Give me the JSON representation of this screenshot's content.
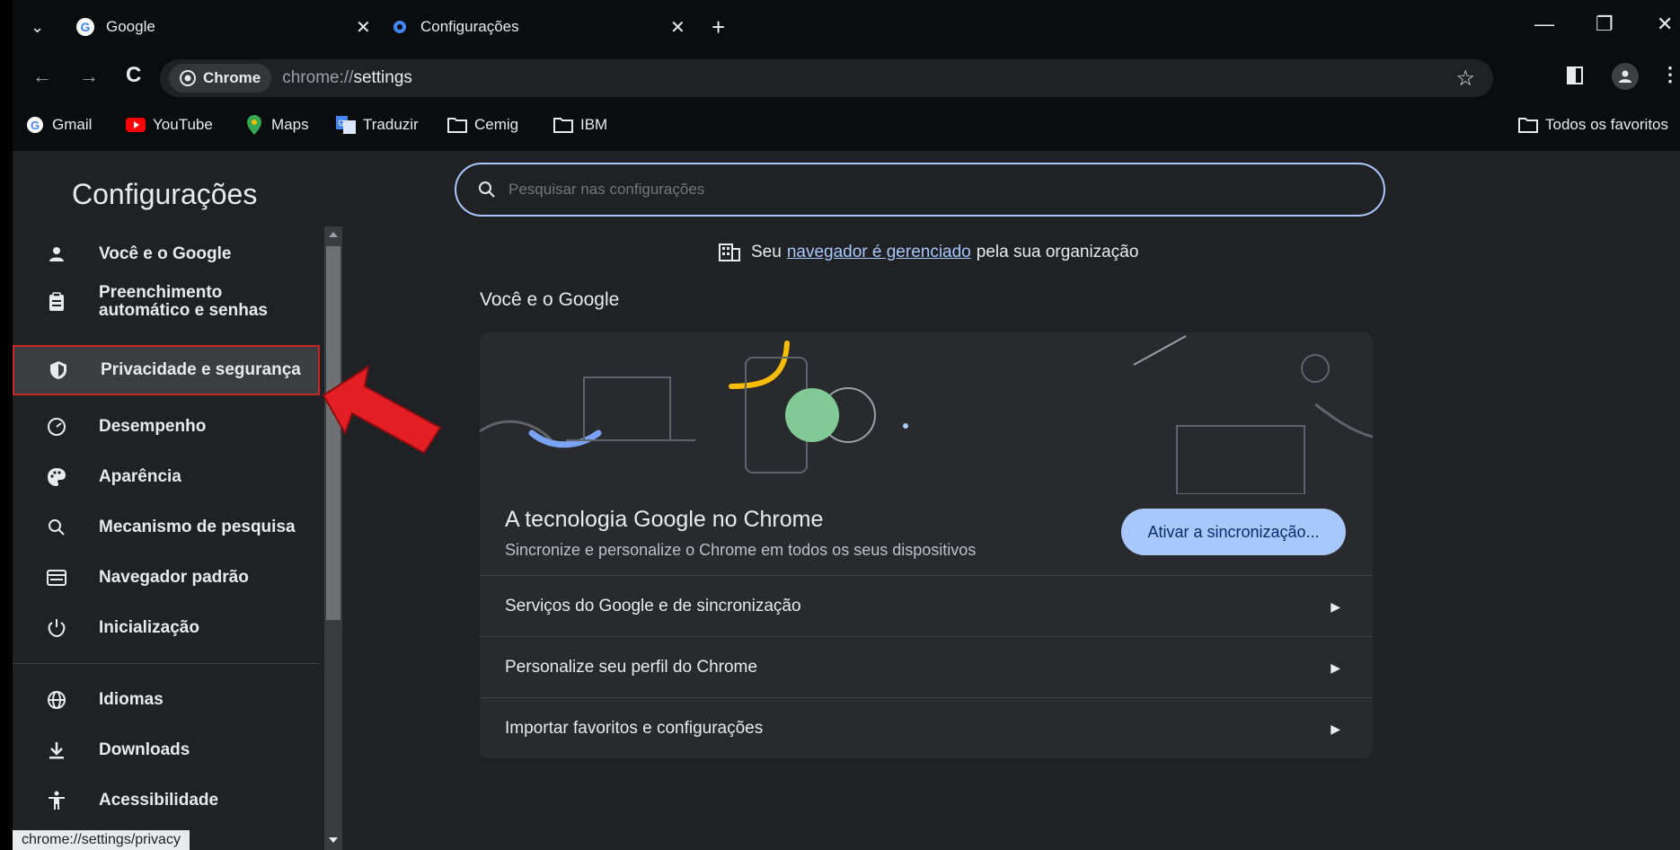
{
  "tabs": [
    {
      "title": "Google",
      "close": "✕"
    },
    {
      "title": "Configurações",
      "close": "✕"
    }
  ],
  "new_tab": "+",
  "tab_menu": "⌄",
  "window_controls": {
    "minimize": "—",
    "restore": "❐",
    "close": "✕"
  },
  "omnibox": {
    "chip": "Chrome",
    "url_prefix": "chrome://",
    "url_path": "settings"
  },
  "bookmarks": [
    {
      "label": "Gmail",
      "icon": "google-icon"
    },
    {
      "label": "YouTube",
      "icon": "youtube-icon"
    },
    {
      "label": "Maps",
      "icon": "maps-pin-icon"
    },
    {
      "label": "Traduzir",
      "icon": "translate-icon"
    },
    {
      "label": "Cemig",
      "icon": "folder-icon"
    },
    {
      "label": "IBM",
      "icon": "folder-icon"
    }
  ],
  "all_bookmarks": "Todos os favoritos",
  "sidebar": {
    "title": "Configurações",
    "items": [
      {
        "label": "Você e o Google",
        "icon": "person-icon"
      },
      {
        "label": "Preenchimento automático e senhas",
        "icon": "clipboard-icon"
      },
      {
        "label": "Privacidade e segurança",
        "icon": "shield-icon"
      },
      {
        "label": "Desempenho",
        "icon": "speedometer-icon"
      },
      {
        "label": "Aparência",
        "icon": "palette-icon"
      },
      {
        "label": "Mecanismo de pesquisa",
        "icon": "search-icon"
      },
      {
        "label": "Navegador padrão",
        "icon": "browser-icon"
      },
      {
        "label": "Inicialização",
        "icon": "power-icon"
      },
      {
        "label": "Idiomas",
        "icon": "globe-icon"
      },
      {
        "label": "Downloads",
        "icon": "download-icon"
      },
      {
        "label": "Acessibilidade",
        "icon": "accessibility-icon"
      }
    ]
  },
  "search": {
    "placeholder": "Pesquisar nas configurações"
  },
  "managed": {
    "prefix": "Seu",
    "link": "navegador é gerenciado",
    "suffix": "pela sua organização"
  },
  "section_title": "Você e o Google",
  "card": {
    "heading": "A tecnologia Google no Chrome",
    "subheading": "Sincronize e personalize o Chrome em todos os seus dispositivos",
    "sync_button": "Ativar a sincronização...",
    "rows": [
      "Serviços do Google e de sincronização",
      "Personalize seu perfil do Chrome",
      "Importar favoritos e configurações"
    ]
  },
  "status_url": "chrome://settings/privacy",
  "colors": {
    "accent": "#a8c7fa",
    "highlight": "#c62828",
    "arrow": "#e31e24"
  }
}
